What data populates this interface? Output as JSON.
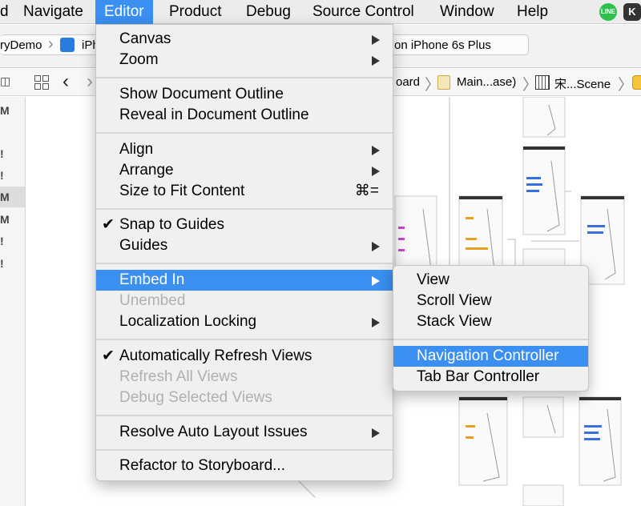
{
  "menubar": {
    "items": [
      {
        "label": "d"
      },
      {
        "label": "Navigate"
      },
      {
        "label": "Editor"
      },
      {
        "label": "Product"
      },
      {
        "label": "Debug"
      },
      {
        "label": "Source Control"
      },
      {
        "label": "Window"
      },
      {
        "label": "Help"
      }
    ],
    "active_item": "Editor",
    "line_badge": "LINE",
    "k_badge": "K"
  },
  "scheme_bar": {
    "scheme": "ryDemo",
    "device_partial": "iPh",
    "status": "on iPhone 6s Plus"
  },
  "jump_bar": {
    "crumb_1": "oard",
    "crumb_2": "Main...ase)",
    "crumb_3": "宋...Scene"
  },
  "navigator": {
    "rows": [
      "M",
      "!",
      "!",
      "M",
      "M",
      "!",
      "!"
    ],
    "selected_row": 3
  },
  "editor_menu": {
    "canvas": "Canvas",
    "zoom": "Zoom",
    "show_document_outline": "Show Document Outline",
    "reveal_in_document_outline": "Reveal in Document Outline",
    "align": "Align",
    "arrange": "Arrange",
    "size_to_fit_content": "Size to Fit Content",
    "size_to_fit_shortcut": "⌘=",
    "snap_to_guides": "Snap to Guides",
    "guides": "Guides",
    "embed_in": "Embed In",
    "unembed": "Unembed",
    "localization_locking": "Localization Locking",
    "automatically_refresh_views": "Automatically Refresh Views",
    "refresh_all_views": "Refresh All Views",
    "debug_selected_views": "Debug Selected Views",
    "resolve_auto_layout_issues": "Resolve Auto Layout Issues",
    "refactor_to_storyboard": "Refactor to Storyboard...",
    "checkmark": "✔"
  },
  "embed_submenu": {
    "view": "View",
    "scroll_view": "Scroll View",
    "stack_view": "Stack View",
    "navigation_controller": "Navigation Controller",
    "tab_bar_controller": "Tab Bar Controller"
  },
  "icons": {
    "back": "‹",
    "forward": "›",
    "crumb_chevron": "〉",
    "scheme_chevron": "›"
  },
  "colors": {
    "highlight": "#3a8ff0",
    "menu_bg": "#f0f0f0",
    "disabled_text": "#b0b0b0",
    "line_green": "#2fbf4b"
  }
}
